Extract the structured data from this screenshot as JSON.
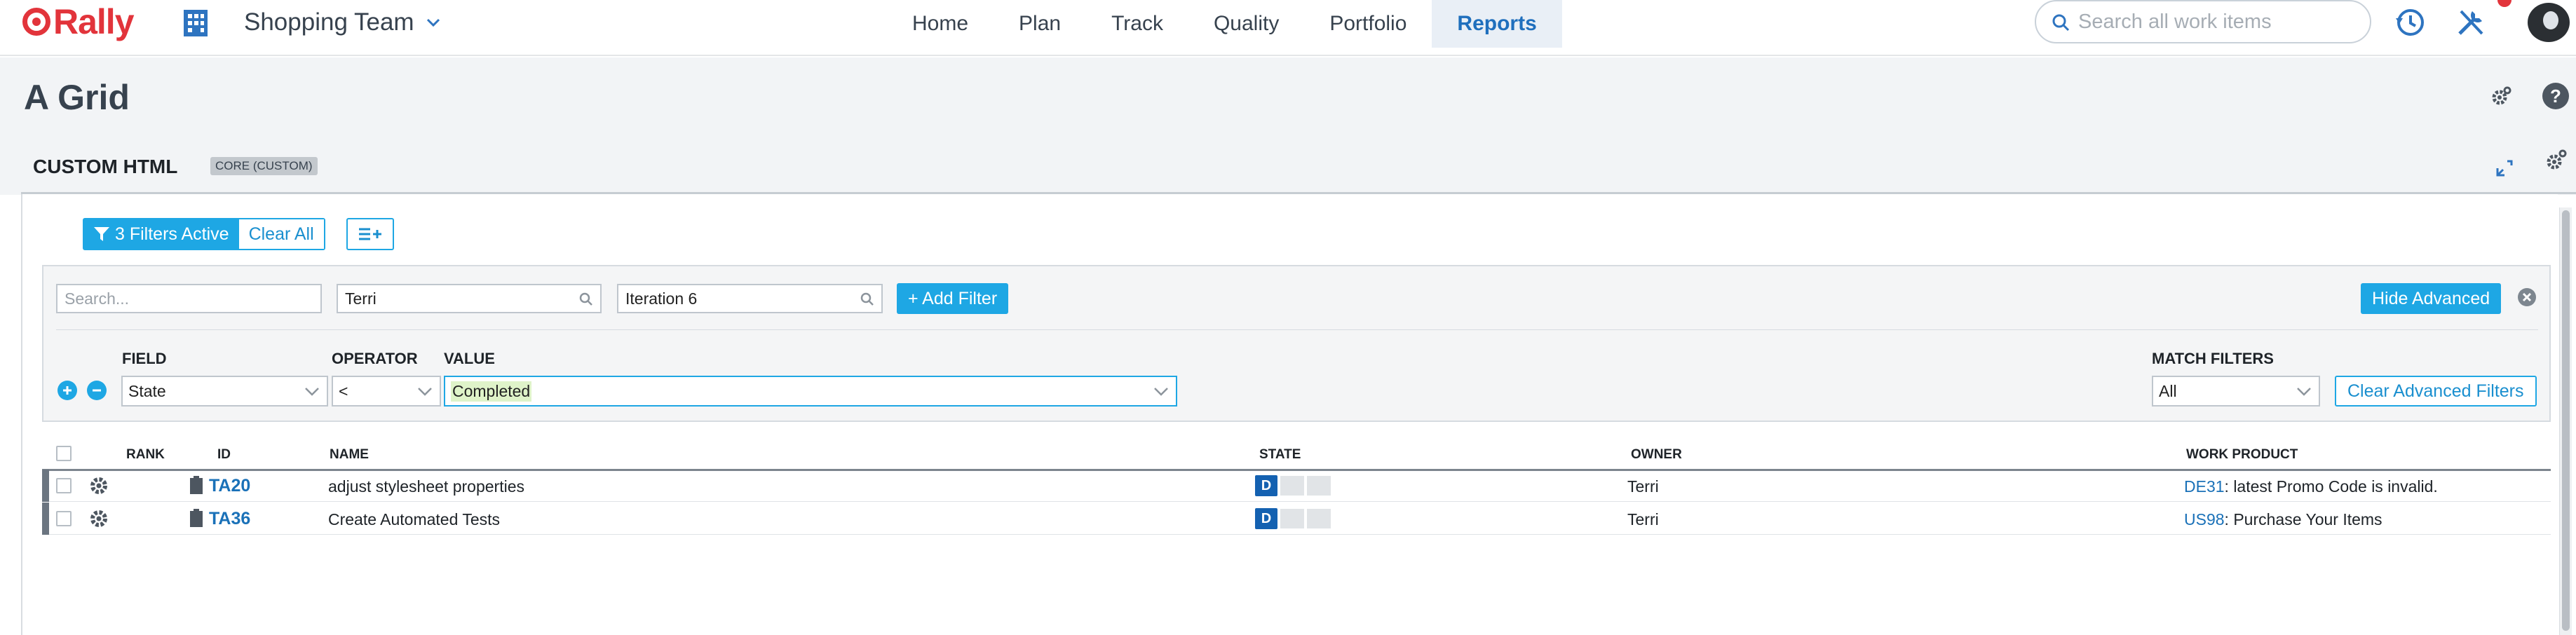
{
  "app": {
    "logo_text": "Rally",
    "workspace": "Shopping Team",
    "search_placeholder": "Search all work items",
    "nav_tabs": [
      {
        "label": "Home"
      },
      {
        "label": "Plan"
      },
      {
        "label": "Track"
      },
      {
        "label": "Quality"
      },
      {
        "label": "Portfolio"
      },
      {
        "label": "Reports",
        "active": true
      }
    ]
  },
  "page": {
    "title": "A Grid"
  },
  "panel": {
    "title": "CUSTOM HTML",
    "badge": "CORE (CUSTOM)"
  },
  "filters": {
    "active_label": "3 Filters Active",
    "clear_all": "Clear All",
    "search_placeholder": "Search...",
    "owner_value": "Terri",
    "iteration_value": "Iteration 6",
    "add_filter": "+ Add Filter",
    "hide_advanced": "Hide Advanced",
    "field_header": "FIELD",
    "operator_header": "OPERATOR",
    "value_header": "VALUE",
    "field_value": "State",
    "operator_value": "<",
    "value_value": "Completed",
    "match_header": "MATCH FILTERS",
    "match_value": "All",
    "clear_advanced": "Clear Advanced Filters"
  },
  "grid": {
    "headers": {
      "rank": "RANK",
      "id": "ID",
      "name": "NAME",
      "state": "STATE",
      "owner": "OWNER",
      "work_product": "WORK PRODUCT"
    },
    "rows": [
      {
        "id": "TA20",
        "name": "adjust stylesheet properties",
        "state": "D",
        "owner": "Terri",
        "wp_id": "DE31",
        "wp_name": ": latest Promo Code is invalid."
      },
      {
        "id": "TA36",
        "name": "Create Automated Tests",
        "state": "D",
        "owner": "Terri",
        "wp_id": "US98",
        "wp_name": ": Purchase Your Items"
      }
    ]
  },
  "colors": {
    "brand_red": "#e2343b",
    "accent_blue": "#1ea7e4",
    "link_blue": "#1a71b8",
    "state_blue": "#1461b1"
  }
}
